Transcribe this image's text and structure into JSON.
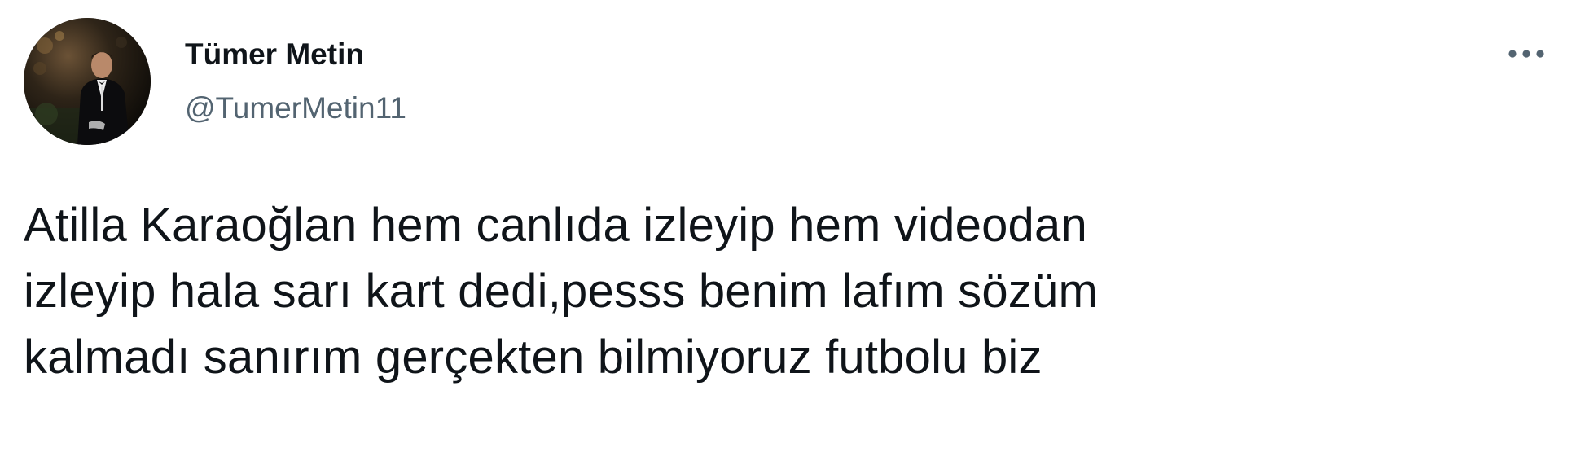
{
  "tweet": {
    "author": {
      "display_name": "Tümer Metin",
      "handle": "@TumerMetin11",
      "avatar_icon": "profile-photo"
    },
    "more_icon": "more-options-icon",
    "text": "Atilla Karaoğlan hem canlıda izleyip hem videodan\nizleyip hala sarı kart dedi,pesss benim lafım sözüm\nkalmadı sanırım gerçekten bilmiyoruz futbolu biz"
  },
  "colors": {
    "text_primary": "#0f1419",
    "text_secondary": "#536471",
    "background": "#ffffff"
  }
}
